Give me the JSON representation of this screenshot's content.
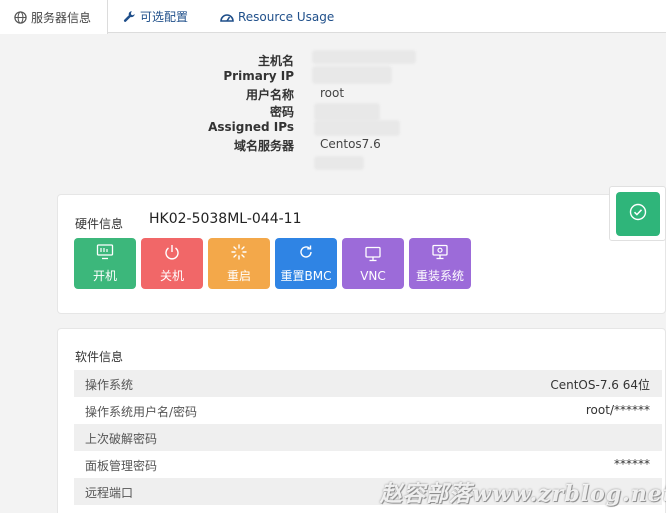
{
  "tabs": [
    {
      "label": "服务器信息",
      "icon": "globe-icon"
    },
    {
      "label": "可选配置",
      "icon": "wrench-icon"
    },
    {
      "label": "Resource Usage",
      "icon": "gauge-icon"
    }
  ],
  "server_info": {
    "hostname_label": "主机名",
    "primary_ip_label": "Primary IP",
    "username_label": "用户名称",
    "username_value": "root",
    "password_label": "密码",
    "assigned_ips_label": "Assigned IPs",
    "nameserver_label": "域名服务器",
    "nameserver_value": "Centos7.6"
  },
  "hardware": {
    "label": "硬件信息",
    "id": "HK02-5038ML-044-11",
    "buttons": [
      {
        "label": "开机",
        "icon": "server-power-on-icon",
        "color": "#3cb77b"
      },
      {
        "label": "关机",
        "icon": "power-icon",
        "color": "#f16768"
      },
      {
        "label": "重启",
        "icon": "spinner-icon",
        "color": "#f3a84a"
      },
      {
        "label": "重置BMC",
        "icon": "refresh-icon",
        "color": "#2f84e4"
      },
      {
        "label": "VNC",
        "icon": "monitor-icon",
        "color": "#9c6bd9"
      },
      {
        "label": "重装系统",
        "icon": "monitor-settings-icon",
        "color": "#9c6bd9"
      }
    ]
  },
  "status_icon": "check-circle-icon",
  "software": {
    "title": "软件信息",
    "rows": [
      {
        "key": "操作系统",
        "value": "CentOS-7.6 64位"
      },
      {
        "key": "操作系统用户名/密码",
        "value": "root/******"
      },
      {
        "key": "上次破解密码",
        "value": ""
      },
      {
        "key": "面板管理密码",
        "value": "******"
      },
      {
        "key": "远程端口",
        "value": ""
      }
    ]
  },
  "watermark": "赵容部落www.zrblog.net"
}
